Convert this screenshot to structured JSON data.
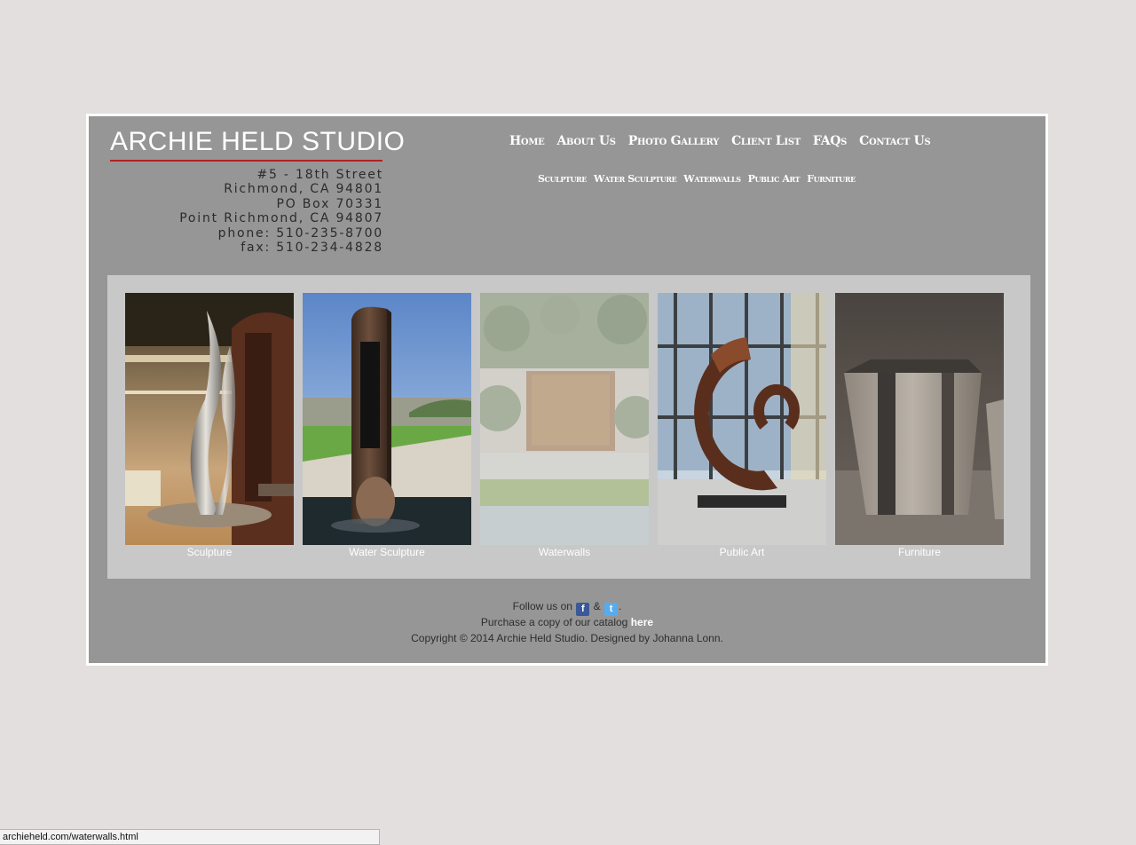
{
  "header": {
    "logo_text": "ARCHIE HELD STUDIO",
    "address": [
      "#5 - 18th Street",
      "Richmond, CA 94801",
      "PO Box 70331",
      "Point Richmond, CA 94807",
      "phone: 510-235-8700",
      "fax: 510-234-4828"
    ]
  },
  "nav": {
    "main": [
      "Home",
      "About Us",
      "Photo Gallery",
      "Client List",
      "FAQs",
      "Contact Us"
    ],
    "sub": [
      "Sculpture",
      "Water Sculpture",
      "Waterwalls",
      "Public Art",
      "Furniture"
    ]
  },
  "gallery": {
    "items": [
      {
        "label": "Sculpture"
      },
      {
        "label": "Water Sculpture"
      },
      {
        "label": "Waterwalls"
      },
      {
        "label": "Public Art"
      },
      {
        "label": "Furniture"
      }
    ]
  },
  "footer": {
    "follow_text": "Follow us on",
    "ampersand": "&",
    "period": ".",
    "catalog_text": "Purchase a copy of our catalog",
    "catalog_link": "here",
    "copyright": "Copyright © 2014 Archie Held Studio. Designed by Johanna Lonn."
  },
  "status_bar": {
    "url": "archieheld.com/waterwalls.html"
  },
  "colors": {
    "page_bg": "#e2dfde",
    "frame_bg": "#969696",
    "gallery_bg": "#c8c8c8",
    "logo_rule": "#b32025",
    "link": "#ffffff"
  }
}
